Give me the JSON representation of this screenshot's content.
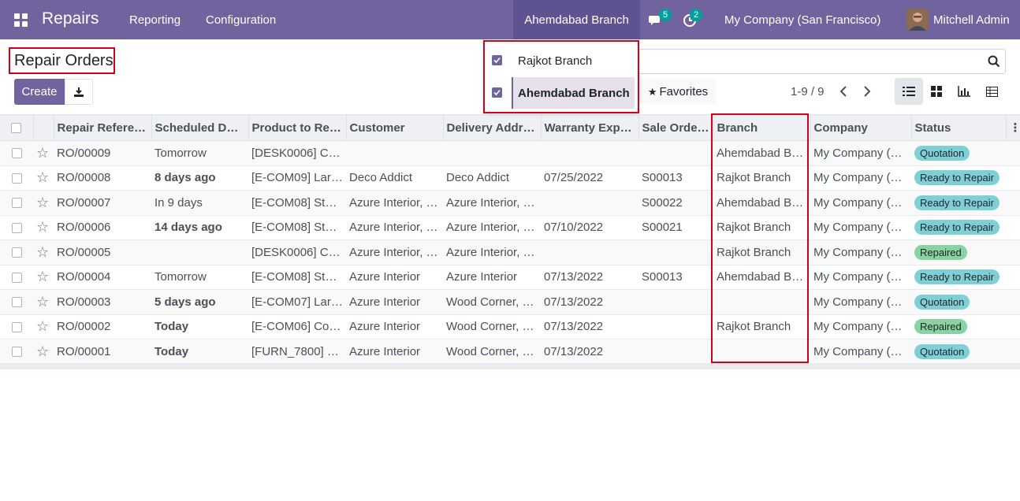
{
  "navbar": {
    "app_name": "Repairs",
    "menus": [
      "Reporting",
      "Configuration"
    ],
    "branch_switcher": "Ahemdabad Branch",
    "messages_count": "5",
    "activities_count": "2",
    "company": "My Company (San Francisco)",
    "user": "Mitchell Admin",
    "color": "#71639e"
  },
  "page": {
    "title": "Repair Orders",
    "create_label": "Create",
    "favorites_label": "Favorites",
    "pager": "1-9 / 9"
  },
  "branch_dropdown": {
    "items": [
      {
        "label": "Rajkot Branch",
        "checked": true,
        "selected": false
      },
      {
        "label": "Ahemdabad Branch",
        "checked": true,
        "selected": true
      }
    ]
  },
  "table": {
    "columns": [
      "Repair Refere…",
      "Scheduled Dat…",
      "Product to Re…",
      "Customer",
      "Delivery Addr…",
      "Warranty Expi…",
      "Sale Order…",
      "Branch",
      "Company",
      "Status"
    ],
    "rows": [
      {
        "ref": "RO/00009",
        "scheduled": "Tomorrow",
        "sched_style": "normal",
        "product": "[DESK0006] Cu…",
        "customer": "",
        "delivery": "",
        "warranty": "",
        "sale_order": "",
        "branch": "Ahemdabad Br…",
        "company": "My Company (…",
        "status": "Quotation",
        "status_style": "quotation"
      },
      {
        "ref": "RO/00008",
        "scheduled": "8 days ago",
        "sched_style": "late",
        "product": "[E-COM09] Lar…",
        "customer": "Deco Addict",
        "delivery": "Deco Addict",
        "warranty": "07/25/2022",
        "sale_order": "S00013",
        "branch": "Rajkot Branch",
        "company": "My Company (…",
        "status": "Ready to Repair",
        "status_style": "ready"
      },
      {
        "ref": "RO/00007",
        "scheduled": "In 9 days",
        "sched_style": "normal",
        "product": "[E-COM08] Sto…",
        "customer": "Azure Interior, …",
        "delivery": "Azure Interior, …",
        "warranty": "",
        "sale_order": "S00022",
        "branch": "Ahemdabad Br…",
        "company": "My Company (…",
        "status": "Ready to Repair",
        "status_style": "ready"
      },
      {
        "ref": "RO/00006",
        "scheduled": "14 days ago",
        "sched_style": "late",
        "product": "[E-COM08] Sto…",
        "customer": "Azure Interior, …",
        "delivery": "Azure Interior, …",
        "warranty": "07/10/2022",
        "sale_order": "S00021",
        "branch": "Rajkot Branch",
        "company": "My Company (…",
        "status": "Ready to Repair",
        "status_style": "ready"
      },
      {
        "ref": "RO/00005",
        "scheduled": "",
        "sched_style": "normal",
        "product": "[DESK0006] Cu…",
        "customer": "Azure Interior, …",
        "delivery": "Azure Interior, …",
        "warranty": "",
        "sale_order": "",
        "branch": "Rajkot Branch",
        "company": "My Company (…",
        "status": "Repaired",
        "status_style": "repaired"
      },
      {
        "ref": "RO/00004",
        "scheduled": "Tomorrow",
        "sched_style": "normal",
        "product": "[E-COM08] Sto…",
        "customer": "Azure Interior",
        "delivery": "Azure Interior",
        "warranty": "07/13/2022",
        "sale_order": "S00013",
        "branch": "Ahemdabad Br…",
        "company": "My Company (…",
        "status": "Ready to Repair",
        "status_style": "ready"
      },
      {
        "ref": "RO/00003",
        "scheduled": "5 days ago",
        "sched_style": "late",
        "product": "[E-COM07] Lar…",
        "customer": "Azure Interior",
        "delivery": "Wood Corner, …",
        "warranty": "07/13/2022",
        "sale_order": "",
        "branch": "",
        "company": "My Company (…",
        "status": "Quotation",
        "status_style": "quotation"
      },
      {
        "ref": "RO/00002",
        "scheduled": "Today",
        "sched_style": "today",
        "product": "[E-COM06] Cor…",
        "customer": "Azure Interior",
        "delivery": "Wood Corner, …",
        "warranty": "07/13/2022",
        "sale_order": "",
        "branch": "Rajkot Branch",
        "company": "My Company (…",
        "status": "Repaired",
        "status_style": "repaired"
      },
      {
        "ref": "RO/00001",
        "scheduled": "Today",
        "sched_style": "today",
        "product": "[FURN_7800] …",
        "customer": "Azure Interior",
        "delivery": "Wood Corner, …",
        "warranty": "07/13/2022",
        "sale_order": "",
        "branch": "",
        "company": "My Company (…",
        "status": "Quotation",
        "status_style": "quotation"
      }
    ]
  }
}
